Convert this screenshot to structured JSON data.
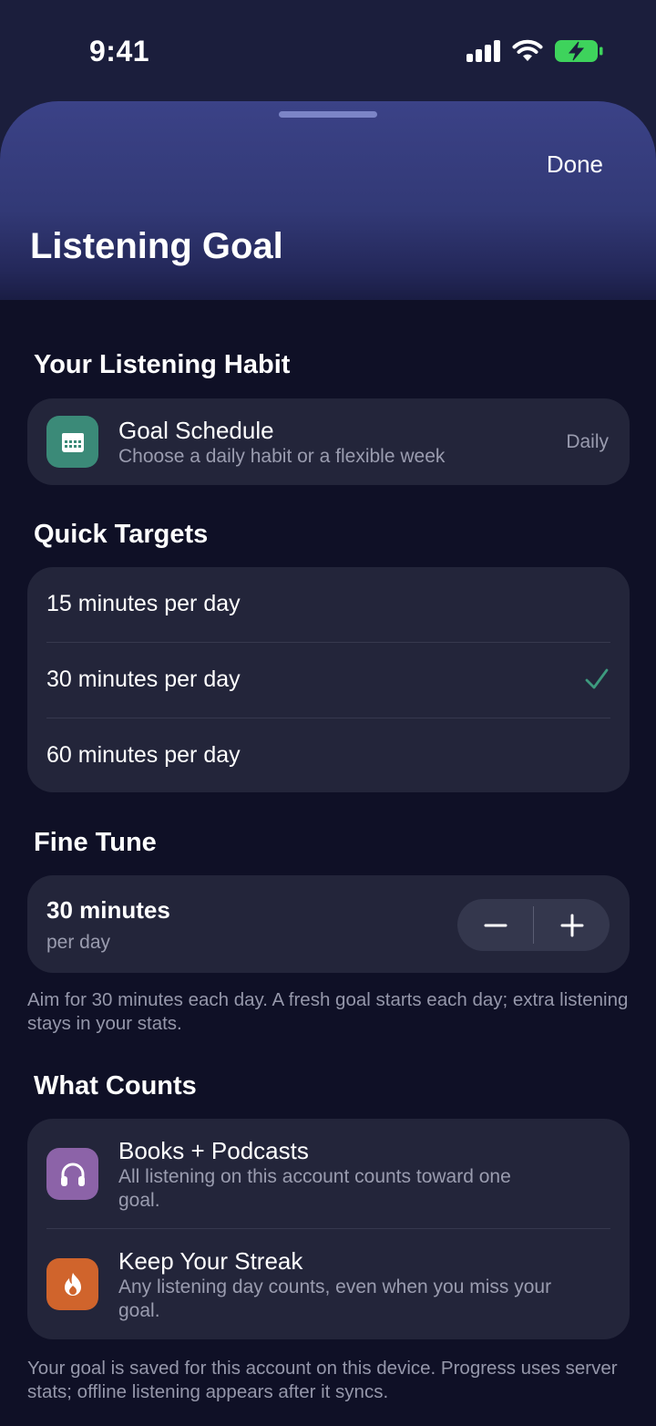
{
  "status_bar": {
    "time": "9:41",
    "icons": [
      "cellular-signal-icon",
      "wifi-icon",
      "battery-charging-icon"
    ],
    "battery_color": "#3ed35c"
  },
  "sheet": {
    "done_label": "Done",
    "title": "Listening Goal"
  },
  "habit_section": {
    "title": "Your Listening Habit",
    "schedule": {
      "icon": "calendar-icon",
      "icon_color": "#3b8a78",
      "title": "Goal Schedule",
      "subtitle": "Choose a daily habit or a flexible week",
      "value": "Daily"
    }
  },
  "quick_targets": {
    "title": "Quick Targets",
    "options": [
      {
        "label": "15 minutes per day",
        "selected": false
      },
      {
        "label": "30 minutes per day",
        "selected": true
      },
      {
        "label": "60 minutes per day",
        "selected": false
      }
    ],
    "check_color": "#3d9a7e"
  },
  "fine_tune": {
    "title": "Fine Tune",
    "value": "30 minutes",
    "unit": "per day",
    "decrement_icon": "minus-icon",
    "increment_icon": "plus-icon",
    "footnote": "Aim for 30 minutes each day. A fresh goal starts each day; extra listening stays in your stats."
  },
  "what_counts": {
    "title": "What Counts",
    "items": [
      {
        "icon": "headphones-icon",
        "icon_color": "#8c63a8",
        "title": "Books + Podcasts",
        "subtitle": "All listening on this account counts toward one goal."
      },
      {
        "icon": "flame-icon",
        "icon_color": "#d0642c",
        "title": "Keep Your Streak",
        "subtitle": "Any listening day counts, even when you miss your goal."
      }
    ],
    "footnote": "Your goal is saved for this account on this device. Progress uses server stats; offline listening appears after it syncs."
  }
}
